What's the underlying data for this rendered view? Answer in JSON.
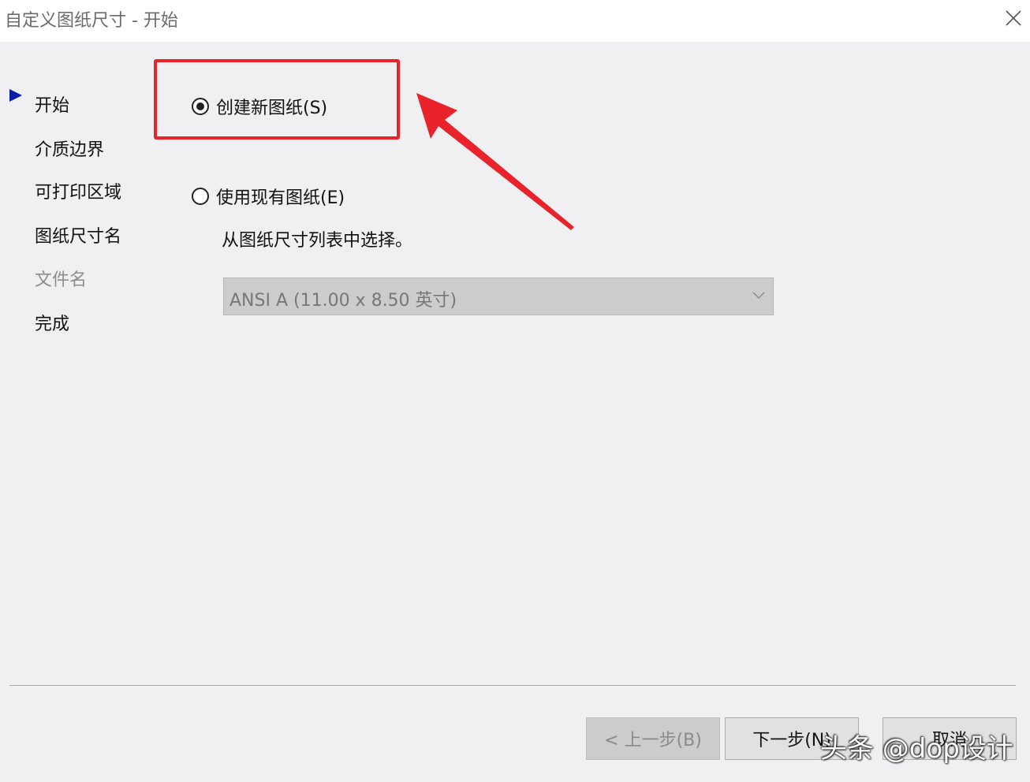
{
  "window": {
    "title": "自定义图纸尺寸 - 开始",
    "close_icon": "close-icon"
  },
  "nav": {
    "items": [
      {
        "label": "开始",
        "current": true,
        "enabled": true
      },
      {
        "label": "介质边界",
        "current": false,
        "enabled": true
      },
      {
        "label": "可打印区域",
        "current": false,
        "enabled": true
      },
      {
        "label": "图纸尺寸名",
        "current": false,
        "enabled": true
      },
      {
        "label": "文件名",
        "current": false,
        "enabled": false
      },
      {
        "label": "完成",
        "current": false,
        "enabled": true
      }
    ],
    "current_icon": "play-arrow-icon"
  },
  "options": {
    "create_new": {
      "label": "创建新图纸(S)",
      "checked": true
    },
    "use_existing": {
      "label": "使用现有图纸(E)",
      "checked": false
    },
    "hint": "从图纸尺寸列表中选择。",
    "size_select": {
      "value": "ANSI A (11.00 x 8.50 英寸)",
      "enabled": false
    }
  },
  "buttons": {
    "back": "< 上一步(B)",
    "next": "下一步(N)",
    "cancel": "取消"
  },
  "annotation": {
    "color": "#e8232a"
  },
  "watermark": "头条 @dop设计"
}
